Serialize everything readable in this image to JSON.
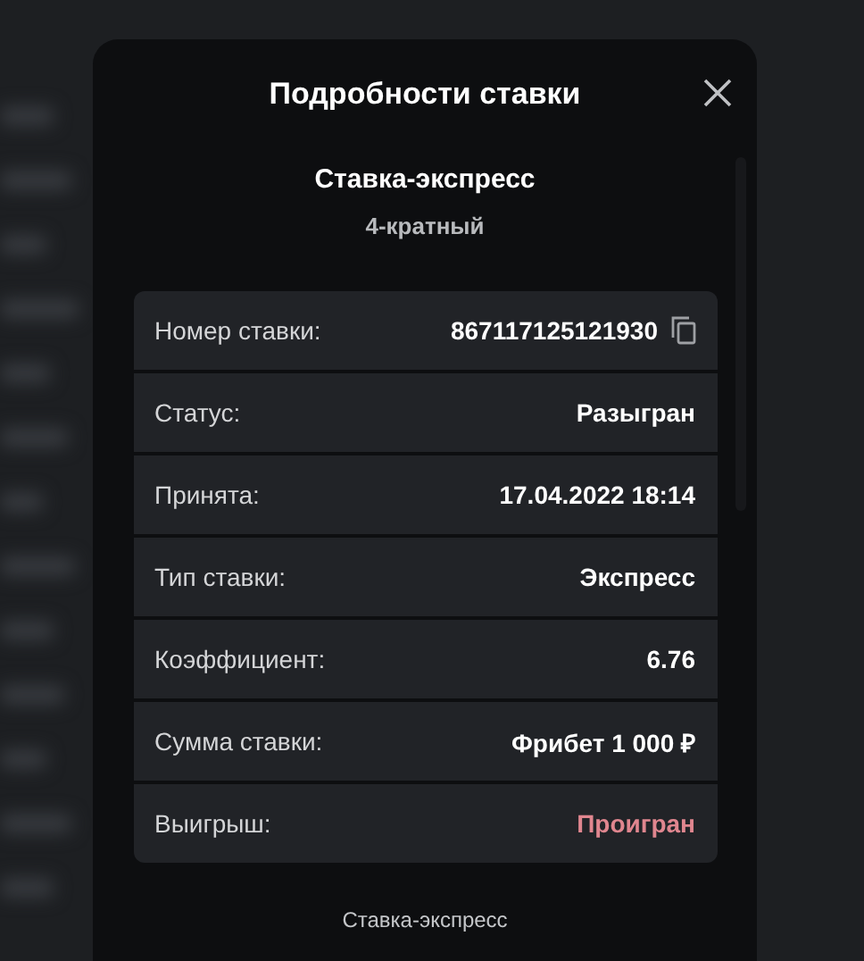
{
  "modal": {
    "title": "Подробности ставки",
    "bet_type": "Ставка-экспресс",
    "multiplicity": "4-кратный",
    "rows": [
      {
        "label": "Номер ставки:",
        "value": "867117125121930",
        "copyable": true,
        "color": "#ffffff"
      },
      {
        "label": "Статус:",
        "value": "Разыгран",
        "copyable": false,
        "color": "#ffffff"
      },
      {
        "label": "Принята:",
        "value": "17.04.2022 18:14",
        "copyable": false,
        "color": "#ffffff"
      },
      {
        "label": "Тип ставки:",
        "value": "Экспресс",
        "copyable": false,
        "color": "#ffffff"
      },
      {
        "label": "Коэффициент:",
        "value": "6.76",
        "copyable": false,
        "color": "#ffffff"
      },
      {
        "label": "Сумма ставки:",
        "value": "Фрибет 1 000 ₽",
        "copyable": false,
        "color": "#ffffff"
      },
      {
        "label": "Выигрыш:",
        "value": "Проигран",
        "copyable": false,
        "color": "#e0868f"
      }
    ],
    "footer": "Ставка-экспресс"
  }
}
